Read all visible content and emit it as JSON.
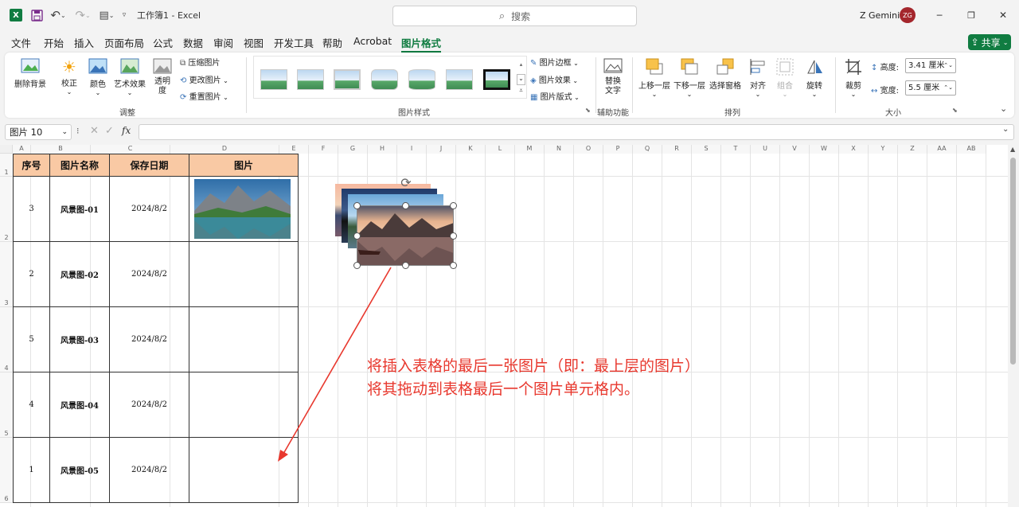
{
  "titlebar": {
    "app_icon": "excel-logo",
    "workbook_title": "工作簿1 - Excel",
    "search_placeholder": "搜索",
    "user_name": "Z Gemini",
    "user_initials": "ZG",
    "minimize": "─",
    "restore": "❐",
    "close": "✕"
  },
  "menu": {
    "items": [
      "文件",
      "开始",
      "插入",
      "页面布局",
      "公式",
      "数据",
      "审阅",
      "视图",
      "开发工具",
      "帮助",
      "Acrobat",
      "图片格式"
    ],
    "active": "图片格式",
    "share_label": "共享"
  },
  "ribbon": {
    "adjust": {
      "remove_bg": "删除背景",
      "correct": "校正",
      "color": "颜色",
      "art_effects": "艺术效果",
      "transparency": "透明度",
      "compress": "压缩图片",
      "change": "更改图片",
      "reset": "重置图片",
      "label": "调整"
    },
    "styles": {
      "label": "图片样式",
      "border": "图片边框",
      "effects": "图片效果",
      "layout": "图片版式"
    },
    "accessibility": {
      "alt_text": "替换文字",
      "label": "辅助功能"
    },
    "arrange": {
      "bring_forward": "上移一层",
      "send_backward": "下移一层",
      "selection_pane": "选择窗格",
      "align": "对齐",
      "group": "组合",
      "rotate": "旋转",
      "label": "排列"
    },
    "size": {
      "crop": "裁剪",
      "height_label": "高度:",
      "height_value": "3.41 厘米",
      "width_label": "宽度:",
      "width_value": "5.5 厘米",
      "label": "大小"
    }
  },
  "formula_bar": {
    "name_box": "图片 10",
    "fx": "fx",
    "value": ""
  },
  "sheet": {
    "columns": [
      "A",
      "B",
      "C",
      "D",
      "E",
      "F",
      "G",
      "H",
      "I",
      "J",
      "K",
      "L",
      "M",
      "N",
      "O",
      "P",
      "Q",
      "R",
      "S",
      "T",
      "U",
      "V",
      "W",
      "X",
      "Y",
      "Z",
      "AA",
      "AB"
    ],
    "rows": [
      "1",
      "2",
      "3",
      "4",
      "5",
      "6"
    ],
    "table_headers": [
      "序号",
      "图片名称",
      "保存日期",
      "图片"
    ],
    "table_rows": [
      {
        "no": "3",
        "name": "风景图-01",
        "date": "2024/8/2"
      },
      {
        "no": "2",
        "name": "风景图-02",
        "date": "2024/8/2"
      },
      {
        "no": "5",
        "name": "风景图-03",
        "date": "2024/8/2"
      },
      {
        "no": "4",
        "name": "风景图-04",
        "date": "2024/8/2"
      },
      {
        "no": "1",
        "name": "风景图-05",
        "date": "2024/8/2"
      }
    ]
  },
  "annotation": {
    "line1": "将插入表格的最后一张图片（即：最上层的图片）",
    "line2": "将其拖动到表格最后一个图片单元格内。",
    "color": "#e8382e"
  }
}
